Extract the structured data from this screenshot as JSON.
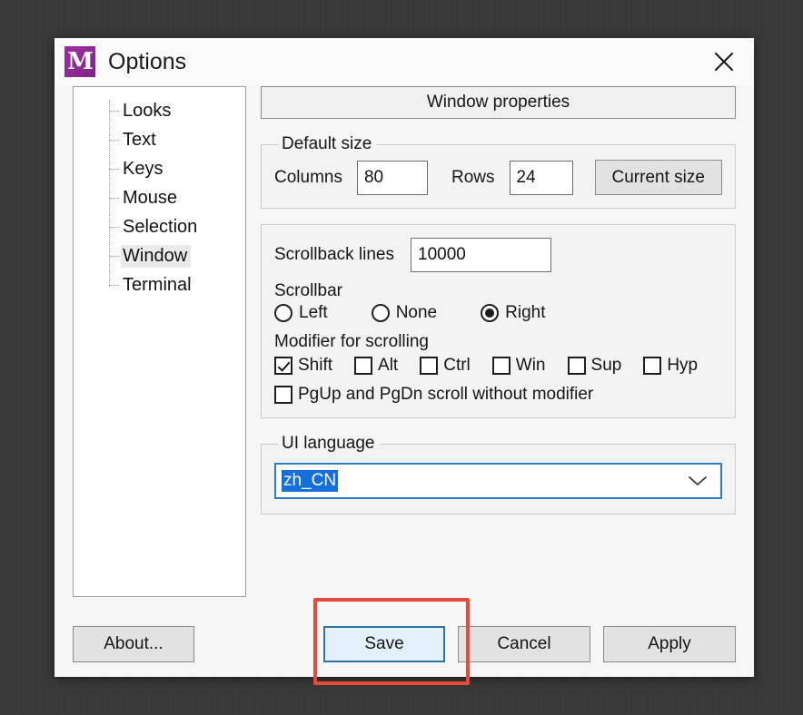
{
  "window": {
    "title": "Options",
    "logo_letter": "M",
    "close_icon": "close-icon"
  },
  "sidebar": {
    "items": [
      {
        "label": "Looks",
        "selected": false
      },
      {
        "label": "Text",
        "selected": false
      },
      {
        "label": "Keys",
        "selected": false
      },
      {
        "label": "Mouse",
        "selected": false
      },
      {
        "label": "Selection",
        "selected": false
      },
      {
        "label": "Window",
        "selected": true
      },
      {
        "label": "Terminal",
        "selected": false
      }
    ]
  },
  "main": {
    "section_title": "Window properties",
    "default_size": {
      "legend": "Default size",
      "columns_label": "Columns",
      "columns_value": "80",
      "rows_label": "Rows",
      "rows_value": "24",
      "current_size_label": "Current size"
    },
    "scrolling": {
      "scrollback_label": "Scrollback lines",
      "scrollback_value": "10000",
      "scrollbar_label": "Scrollbar",
      "scrollbar_options": [
        {
          "label": "Left",
          "checked": false
        },
        {
          "label": "None",
          "checked": false
        },
        {
          "label": "Right",
          "checked": true
        }
      ],
      "modifier_label": "Modifier for scrolling",
      "modifier_options": [
        {
          "label": "Shift",
          "checked": true
        },
        {
          "label": "Alt",
          "checked": false
        },
        {
          "label": "Ctrl",
          "checked": false
        },
        {
          "label": "Win",
          "checked": false
        },
        {
          "label": "Sup",
          "checked": false
        },
        {
          "label": "Hyp",
          "checked": false
        }
      ],
      "pgupdn": {
        "label": "PgUp and PgDn scroll without modifier",
        "checked": false
      }
    },
    "ui_language": {
      "legend": "UI language",
      "selected_value": "zh_CN",
      "arrow_icon": "chevron-down-icon"
    }
  },
  "footer": {
    "about_label": "About...",
    "save_label": "Save",
    "cancel_label": "Cancel",
    "apply_label": "Apply",
    "annotation_color": "#e8493a",
    "save_focus_color": "#2f74a8"
  }
}
